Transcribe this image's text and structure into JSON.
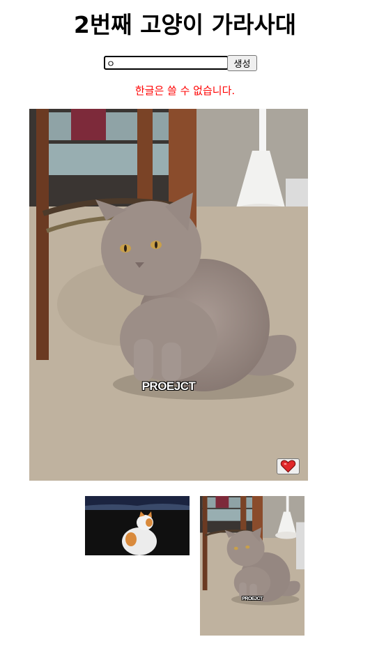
{
  "page": {
    "title": "2번째 고양이 가라사대"
  },
  "form": {
    "input_value": "ㅇ",
    "submit_label": "생성"
  },
  "error_message": "한글은 쓸 수 없습니다.",
  "main_card": {
    "caption": "PROEJCT",
    "favorite_icon": "heart-icon"
  },
  "favorites": [
    {
      "caption": "",
      "icon": "white-orange-cat-photo"
    },
    {
      "caption": "PROEJCT",
      "icon": "grey-cat-photo"
    }
  ],
  "colors": {
    "error": "#ff0000",
    "heart": "#e0282a"
  }
}
